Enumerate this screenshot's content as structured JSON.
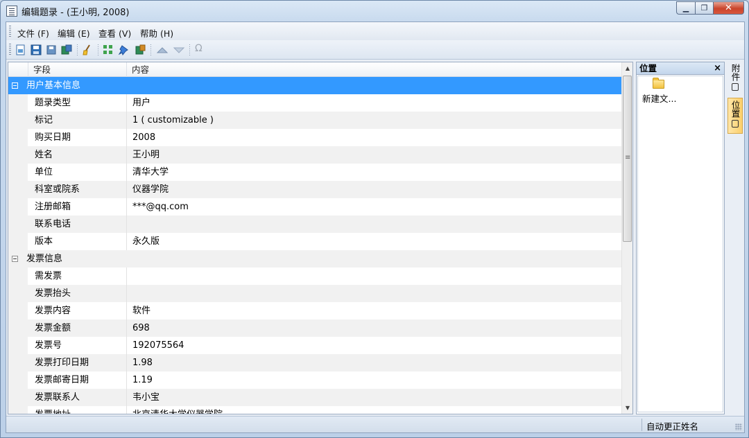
{
  "window": {
    "title": "编辑题录 - (王小明, 2008)",
    "min_label": "▁",
    "max_label": "❐",
    "close_label": "✕"
  },
  "menu": {
    "items": [
      "文件 (F)",
      "编辑 (E)",
      "查看 (V)",
      "帮助 (H)"
    ]
  },
  "toolbar": {
    "icons": [
      "new-record-icon",
      "save-icon",
      "save-as-icon",
      "export-icon",
      "clean-icon",
      "grid-icon",
      "pin-icon",
      "import-icon",
      "move-up-icon",
      "move-down-icon",
      "omega-icon"
    ],
    "omega_label": "Ω"
  },
  "grid": {
    "headers": {
      "field": "字段",
      "content": "内容"
    },
    "categories": [
      {
        "name": "用户基本信息",
        "rows": [
          {
            "field": "题录类型",
            "value": "用户"
          },
          {
            "field": "标记",
            "value": "1 ( customizable )"
          },
          {
            "field": "购买日期",
            "value": "2008"
          },
          {
            "field": "姓名",
            "value": "王小明"
          },
          {
            "field": "单位",
            "value": "清华大学"
          },
          {
            "field": "科室或院系",
            "value": "仪器学院"
          },
          {
            "field": "注册邮箱",
            "value": "***@qq.com"
          },
          {
            "field": "联系电话",
            "value": ""
          },
          {
            "field": "版本",
            "value": "永久版"
          }
        ]
      },
      {
        "name": "发票信息",
        "rows": [
          {
            "field": "需发票",
            "value": ""
          },
          {
            "field": "发票抬头",
            "value": ""
          },
          {
            "field": "发票内容",
            "value": "软件"
          },
          {
            "field": "发票金额",
            "value": "698"
          },
          {
            "field": "发票号",
            "value": "192075564"
          },
          {
            "field": "发票打印日期",
            "value": "1.98"
          },
          {
            "field": "发票邮寄日期",
            "value": "1.19"
          },
          {
            "field": "发票联系人",
            "value": "韦小宝"
          },
          {
            "field": "发票地址",
            "value": "北京清华大学仪器学院"
          }
        ]
      }
    ]
  },
  "side_pane": {
    "title": "位置",
    "close_label": "×",
    "folder_label": "新建文..."
  },
  "vtabs": [
    "附件",
    "位置"
  ],
  "status": {
    "text": "自动更正姓名"
  },
  "colors": {
    "selection": "#3399ff",
    "title_bg": "#dbe8f6"
  }
}
